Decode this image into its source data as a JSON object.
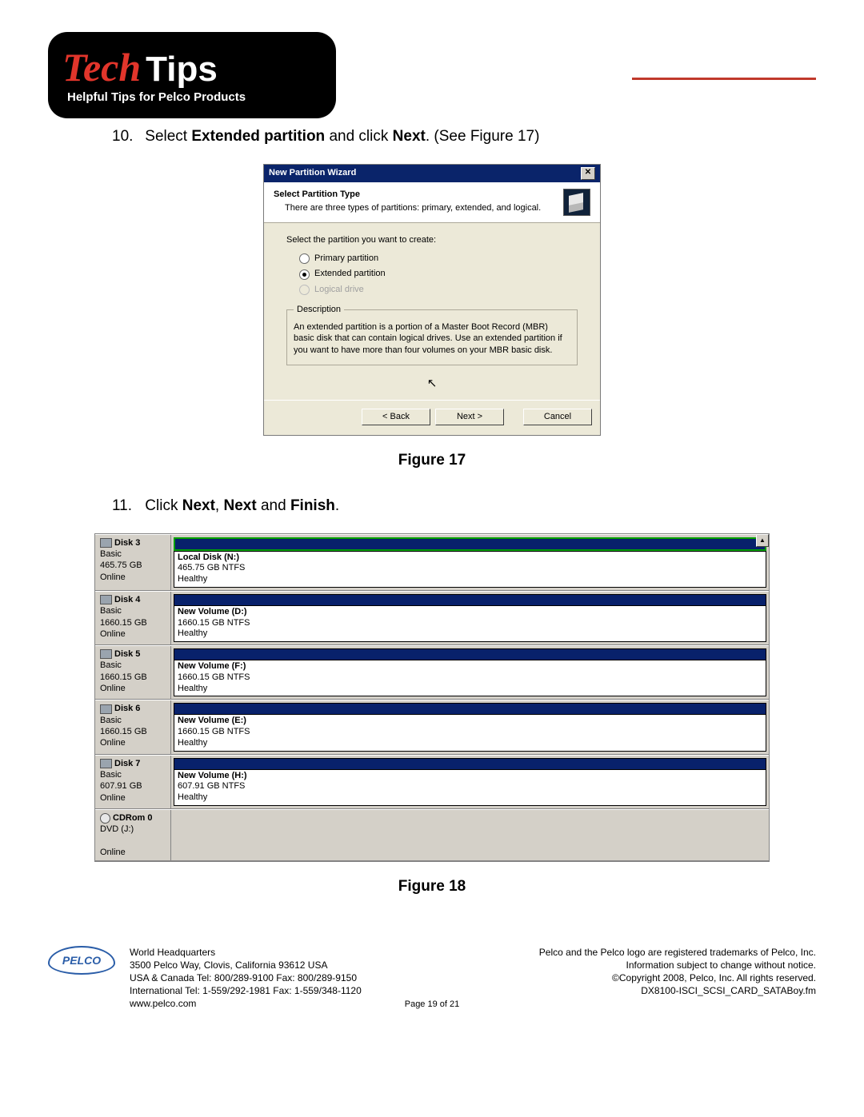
{
  "header": {
    "tech": "Tech",
    "tips": "Tips",
    "sub": "Helpful Tips for Pelco Products"
  },
  "steps": {
    "s10": {
      "num": "10.",
      "pre": "Select ",
      "b1": "Extended partition",
      "mid": " and click ",
      "b2": "Next",
      "post": ". (See Figure 17)"
    },
    "s11": {
      "num": "11.",
      "pre": "Click ",
      "b1": "Next",
      "c1": ", ",
      "b2": "Next",
      "c2": " and ",
      "b3": "Finish",
      "post": "."
    }
  },
  "figcaps": {
    "f17": "Figure 17",
    "f18": "Figure 18"
  },
  "wizard": {
    "title": "New Partition Wizard",
    "close": "✕",
    "htitle": "Select Partition Type",
    "hsub": "There are three types of partitions: primary, extended, and logical.",
    "prompt": "Select the partition you want to create:",
    "opt_primary": "Primary partition",
    "opt_extended": "Extended partition",
    "opt_logical": "Logical drive",
    "desc_legend": "Description",
    "desc_text": "An extended partition is a portion of a Master Boot Record (MBR) basic disk that can contain logical drives. Use an extended partition if you want to have more than four volumes on your MBR basic disk.",
    "btn_back": "< Back",
    "btn_next": "Next >",
    "btn_cancel": "Cancel"
  },
  "dm": {
    "rows": [
      {
        "id": "d3",
        "name": "Disk 3",
        "type": "Basic",
        "size": "465.75 GB",
        "status": "Online",
        "vname": "Local Disk  (N:)",
        "vinfo": "465.75 GB NTFS",
        "vhealth": "Healthy",
        "green": true
      },
      {
        "id": "d4",
        "name": "Disk 4",
        "type": "Basic",
        "size": "1660.15 GB",
        "status": "Online",
        "vname": "New Volume  (D:)",
        "vinfo": "1660.15 GB NTFS",
        "vhealth": "Healthy",
        "green": false
      },
      {
        "id": "d5",
        "name": "Disk 5",
        "type": "Basic",
        "size": "1660.15 GB",
        "status": "Online",
        "vname": "New Volume  (F:)",
        "vinfo": "1660.15 GB NTFS",
        "vhealth": "Healthy",
        "green": false
      },
      {
        "id": "d6",
        "name": "Disk 6",
        "type": "Basic",
        "size": "1660.15 GB",
        "status": "Online",
        "vname": "New Volume  (E:)",
        "vinfo": "1660.15 GB NTFS",
        "vhealth": "Healthy",
        "green": false
      },
      {
        "id": "d7",
        "name": "Disk 7",
        "type": "Basic",
        "size": "607.91 GB",
        "status": "Online",
        "vname": "New Volume  (H:)",
        "vinfo": "607.91 GB NTFS",
        "vhealth": "Healthy",
        "green": false
      },
      {
        "id": "cd0",
        "name": "CDRom 0",
        "type": "DVD (J:)",
        "size": "",
        "status": "Online",
        "vname": "",
        "vinfo": "",
        "vhealth": "",
        "cd": true
      }
    ]
  },
  "footer": {
    "hq_title": "World Headquarters",
    "hq_addr": "3500 Pelco Way, Clovis, California 93612 USA",
    "hq_tel": "USA & Canada  Tel: 800/289-9100  Fax: 800/289-9150",
    "hq_intl": "International Tel: 1-559/292-1981 Fax: 1-559/348-1120",
    "hq_web": "www.pelco.com",
    "tm": "Pelco and the Pelco logo are registered trademarks of Pelco, Inc.",
    "info": "Information subject to change without notice.",
    "cr": "©Copyright 2008, Pelco, Inc. All rights reserved.",
    "doc": "DX8100-ISCI_SCSI_CARD_SATABoy.fm",
    "page": "Page 19 of 21",
    "logo": "PELCO"
  }
}
